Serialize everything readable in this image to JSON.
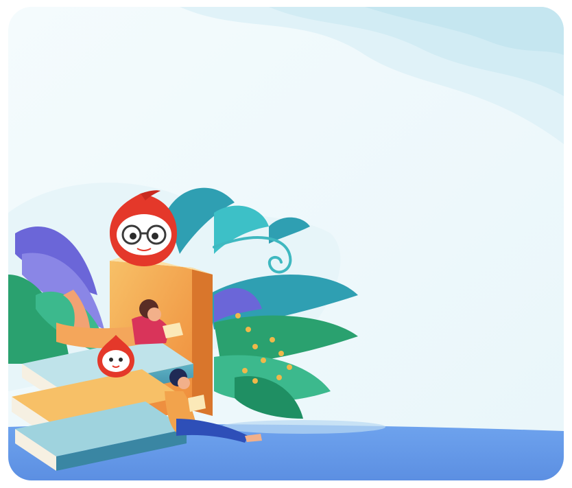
{
  "illustration": {
    "subject": "reading-books-illustration",
    "palette": {
      "sky": "#eaf7fb",
      "wave_light": "#e2f3f8",
      "wave_mid": "#cdeaf2",
      "ground": "#6c9eea",
      "book_orange": "#f2a34c",
      "book_teal": "#3b8aa6",
      "book_pages": "#f6f0e2",
      "leaf_green": "#2fa878",
      "leaf_teal": "#2f9fb2",
      "leaf_purple": "#6a63d6",
      "mascot_red": "#e4382a",
      "berry_yellow": "#f0b84a"
    },
    "icons": [
      "mascot-glasses-icon",
      "mascot-small-icon"
    ]
  }
}
